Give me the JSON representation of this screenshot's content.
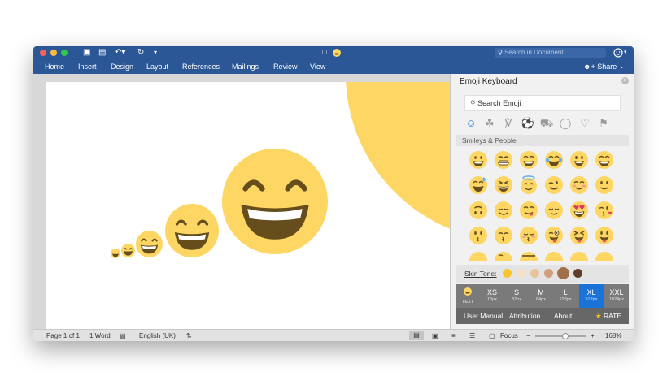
{
  "titlebar": {
    "search_placeholder": "Search in Document",
    "icons": [
      "sidebar-icon",
      "save-icon",
      "undo-icon",
      "redo-icon",
      "customize-icon",
      "document-icon",
      "emoji-icon",
      "smiley-account-icon"
    ]
  },
  "ribbon": {
    "tabs": [
      "Home",
      "Insert",
      "Design",
      "Layout",
      "References",
      "Mailings",
      "Review",
      "View"
    ],
    "share_label": "Share"
  },
  "status": {
    "page": "Page 1 of 1",
    "words": "1 Word",
    "language": "English (UK)",
    "focus": "Focus",
    "zoom": "168%",
    "zoom_fraction": 0.6
  },
  "panel": {
    "title": "Emoji Keyboard",
    "search_placeholder": "Search Emoji",
    "categories": [
      "smileys-icon",
      "nature-icon",
      "food-icon",
      "activity-icon",
      "travel-icon",
      "objects-icon",
      "symbols-icon",
      "flags-icon"
    ],
    "section": "Smileys & People",
    "skin_label": "Skin Tone:",
    "skin_tones": [
      "#f7c52f",
      "#f4e1c5",
      "#e8c49b",
      "#d39e7a",
      "#a26f4b",
      "#5b3e2b"
    ],
    "sizes": [
      {
        "label": "TEXT",
        "sub": ""
      },
      {
        "label": "XS",
        "sub": "16px"
      },
      {
        "label": "S",
        "sub": "32px"
      },
      {
        "label": "M",
        "sub": "64px"
      },
      {
        "label": "L",
        "sub": "128px"
      },
      {
        "label": "XL",
        "sub": "512px"
      },
      {
        "label": "XXL",
        "sub": "1024px"
      }
    ],
    "footer": {
      "manual": "User Manual",
      "attribution": "Attribution",
      "about": "About",
      "rate": "RATE"
    }
  },
  "colors": {
    "word_blue": "#2b5797",
    "emoji_yellow": "#fdd663",
    "emoji_dark": "#664e1c",
    "selected_size": "#1a73d9"
  }
}
